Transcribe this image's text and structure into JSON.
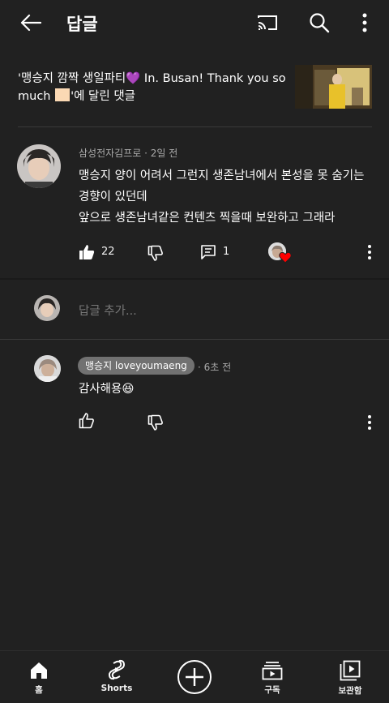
{
  "header": {
    "title": "답글",
    "back_icon": "arrow-left-icon",
    "cast_icon": "cast-icon",
    "search_icon": "search-icon",
    "more_icon": "more-vert-icon"
  },
  "video": {
    "caption_part1": "'맹승지 깜짝 생일파티",
    "caption_part2": " In. Busan! Thank you so much ",
    "caption_part3": "'에 달린 댓글",
    "emoji": "💜"
  },
  "comment": {
    "author": "삼성전자김프로",
    "time": "2일 전",
    "separator": "·",
    "lines": [
      "맹승지 양이 어려서 그런지 생존남녀에서 본성을 못 숨기는",
      "경향이 있던데",
      "앞으로 생존남녀같은 컨텐츠 찍을때 보완하고 그래라"
    ],
    "like_count": "22",
    "reply_count": "1"
  },
  "add_reply": {
    "placeholder": "답글 추가..."
  },
  "reply": {
    "author": "맹승지 loveyoumaeng",
    "separator": "·",
    "time": "6초 전",
    "text": "감사해용😆"
  },
  "nav": {
    "items": [
      {
        "label": "홈",
        "icon": "home-icon"
      },
      {
        "label": "Shorts",
        "icon": "shorts-icon"
      },
      {
        "label": "",
        "icon": "create-icon"
      },
      {
        "label": "구독",
        "icon": "subscriptions-icon"
      },
      {
        "label": "보관함",
        "icon": "library-icon"
      }
    ]
  },
  "colors": {
    "background": "#212121",
    "text": "#f1f1f1",
    "secondary": "#aaaaaa",
    "heart": "#ff0000",
    "chip": "#717171"
  }
}
